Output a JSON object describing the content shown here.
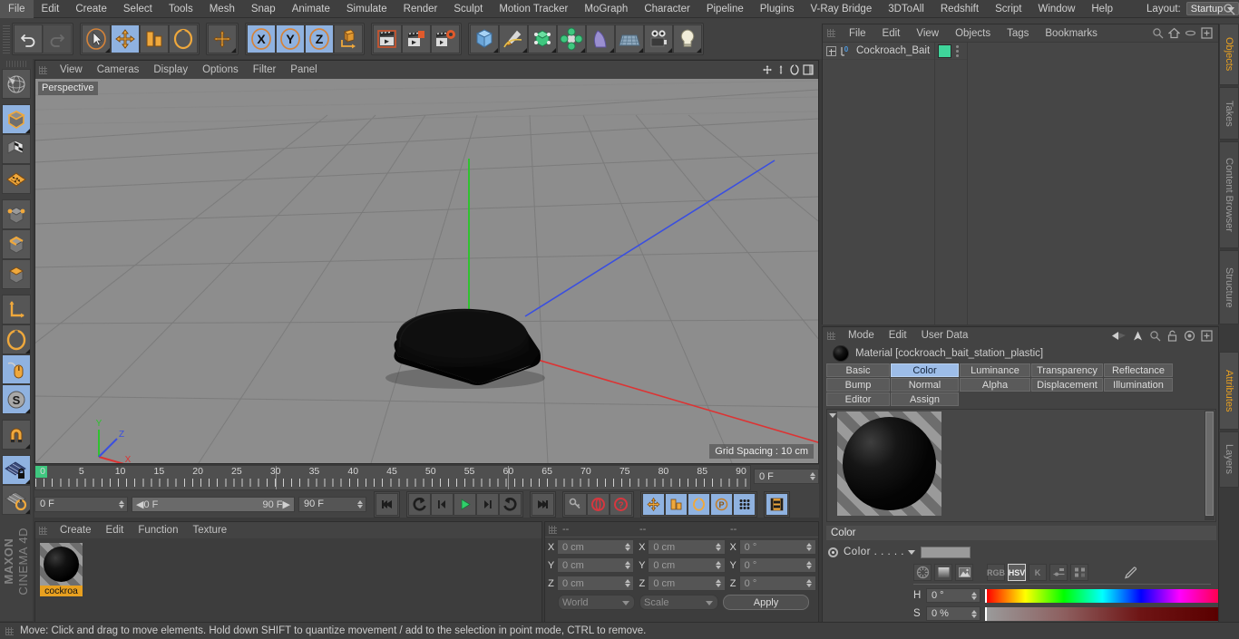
{
  "menubar": {
    "items": [
      "File",
      "Edit",
      "Create",
      "Select",
      "Tools",
      "Mesh",
      "Snap",
      "Animate",
      "Simulate",
      "Render",
      "Sculpt",
      "Motion Tracker",
      "MoGraph",
      "Character",
      "Pipeline",
      "Plugins",
      "V-Ray Bridge",
      "3DToAll",
      "Redshift",
      "Script",
      "Window",
      "Help"
    ],
    "layout_label": "Layout:",
    "layout_value": "Startup",
    "search_icon": "search-icon"
  },
  "toolbar": {
    "groups": [
      {
        "name": "undo-group",
        "buttons": [
          {
            "name": "undo",
            "icon": "undo-arrow-icon",
            "active": false,
            "disabled": false
          },
          {
            "name": "redo",
            "icon": "redo-arrow-icon",
            "active": false,
            "disabled": true
          }
        ]
      },
      {
        "name": "transform-group",
        "buttons": [
          {
            "name": "select",
            "icon": "cursor-arrow-icon",
            "active": false
          },
          {
            "name": "move",
            "icon": "move-axis-icon",
            "active": true
          },
          {
            "name": "scale",
            "icon": "scale-box-icon",
            "active": false
          },
          {
            "name": "rotate",
            "icon": "rotate-ring-icon",
            "active": false
          }
        ]
      },
      {
        "name": "world-group",
        "buttons": [
          {
            "name": "world-coordinate",
            "icon": "plus-axis-icon",
            "active": false
          }
        ]
      },
      {
        "name": "axis-lock-group",
        "buttons": [
          {
            "name": "lock-x",
            "icon": "x-axis-icon",
            "active": true
          },
          {
            "name": "lock-y",
            "icon": "y-axis-icon",
            "active": true
          },
          {
            "name": "lock-z",
            "icon": "z-axis-icon",
            "active": true
          },
          {
            "name": "object-world-toggle",
            "icon": "cube-axis-icon",
            "active": false
          }
        ]
      },
      {
        "name": "render-group",
        "buttons": [
          {
            "name": "render-view",
            "icon": "clapperboard-icon",
            "active": false
          },
          {
            "name": "render-region",
            "icon": "clapper-picture-icon",
            "active": false
          },
          {
            "name": "render-settings",
            "icon": "clapper-gear-icon",
            "active": false
          }
        ]
      },
      {
        "name": "create-group",
        "buttons": [
          {
            "name": "add-cube",
            "icon": "blue-cube-icon",
            "active": false
          },
          {
            "name": "add-spline",
            "icon": "pen-spline-icon",
            "active": false
          },
          {
            "name": "add-generator",
            "icon": "green-cube-icon",
            "active": false
          },
          {
            "name": "add-array",
            "icon": "green-cluster-icon",
            "active": false
          },
          {
            "name": "add-deformer",
            "icon": "bend-deformer-icon",
            "active": false
          },
          {
            "name": "add-environment",
            "icon": "floor-grid-icon",
            "active": false
          },
          {
            "name": "add-camera",
            "icon": "camera-icon",
            "active": false
          },
          {
            "name": "add-light",
            "icon": "light-bulb-icon",
            "active": false
          }
        ]
      }
    ]
  },
  "lefttoolbar": {
    "buttons": [
      {
        "name": "make-editable",
        "icon": "globe-sphere-icon",
        "active": false
      },
      {
        "name": "model-mode",
        "icon": "orange-cube-icon",
        "active": true
      },
      {
        "name": "texture-mode",
        "icon": "checker-cube-icon",
        "active": false
      },
      {
        "name": "uv-mesh-mode",
        "icon": "orange-grid-icon",
        "active": false
      },
      {
        "name": "point-mode",
        "icon": "point-cube-icon",
        "active": false
      },
      {
        "name": "edge-mode",
        "icon": "edge-cube-icon",
        "active": false
      },
      {
        "name": "polygon-mode",
        "icon": "polygon-cube-icon",
        "active": false
      },
      {
        "name": "axis-mode",
        "icon": "axis-corner-icon",
        "active": false
      },
      {
        "name": "enable-snap",
        "icon": "magnet-ring-icon",
        "active": false
      },
      {
        "name": "viewport-solo",
        "icon": "mouse-cursor-icon",
        "active": true
      },
      {
        "name": "soft-selection",
        "icon": "s-compass-icon",
        "active": true
      },
      {
        "name": "snap-settings",
        "icon": "magnet-icon",
        "active": false
      },
      {
        "name": "workplane-lock",
        "icon": "grid-lock-icon",
        "active": true
      },
      {
        "name": "workplane-rotate",
        "icon": "grid-rotate-icon",
        "active": false
      }
    ],
    "brand_line1": "MAXON",
    "brand_line2": "CINEMA 4D"
  },
  "viewport": {
    "menu": [
      "View",
      "Cameras",
      "Display",
      "Options",
      "Filter",
      "Panel"
    ],
    "label": "Perspective",
    "grid_spacing": "Grid Spacing : 10 cm",
    "axis_labels": {
      "x": "X",
      "y": "Y",
      "z": "Z"
    },
    "axis_colors": {
      "x": "#dd3333",
      "y": "#2fc22f",
      "z": "#3a4fe0"
    },
    "background": "#8d8d8d",
    "object_color": "#050505",
    "corner_icons": [
      "move-viewport-icon",
      "pan-viewport-icon",
      "rotate-viewport-icon",
      "maximize-viewport-icon"
    ]
  },
  "timeline": {
    "ticks": [
      "0",
      "5",
      "10",
      "15",
      "20",
      "25",
      "30",
      "35",
      "40",
      "45",
      "50",
      "55",
      "60",
      "65",
      "70",
      "75",
      "80",
      "85",
      "90"
    ],
    "current_frame_field": "0 F",
    "start_field": "0 F",
    "scrub_start": "0 F",
    "scrub_end": "90 F",
    "end_field": "90 F",
    "playhead_frames": [
      30,
      60
    ],
    "transport": [
      {
        "name": "go-to-start",
        "icon": "skip-start-icon"
      },
      {
        "name": "previous-keyframe",
        "icon": "prev-key-icon"
      },
      {
        "name": "step-back",
        "icon": "step-back-icon"
      },
      {
        "name": "play",
        "icon": "play-icon",
        "accent": "#2fd06a"
      },
      {
        "name": "step-forward",
        "icon": "step-forward-icon"
      },
      {
        "name": "next-keyframe",
        "icon": "next-key-icon"
      },
      {
        "name": "go-to-end",
        "icon": "skip-end-icon"
      }
    ],
    "record_group": [
      {
        "name": "autokey",
        "icon": "key-icon",
        "active": false
      },
      {
        "name": "record-active-objects",
        "icon": "record-circle-icon",
        "accent": "#d6373f"
      },
      {
        "name": "keyframe-help",
        "icon": "question-circle-icon",
        "accent": "#d6373f"
      }
    ],
    "key_toggles": [
      {
        "name": "key-position",
        "icon": "move-key-icon",
        "active": true
      },
      {
        "name": "key-scale",
        "icon": "scale-key-icon",
        "active": true
      },
      {
        "name": "key-rotation",
        "icon": "rotate-key-icon",
        "active": true
      },
      {
        "name": "key-param",
        "icon": "p-circle-icon",
        "active": true
      },
      {
        "name": "key-pla",
        "icon": "dots-key-icon",
        "active": true
      }
    ],
    "timeline_toggle": {
      "name": "show-timeline",
      "icon": "filmstrip-icon",
      "active": true
    }
  },
  "material_manager": {
    "menu": [
      "Create",
      "Edit",
      "Function",
      "Texture"
    ],
    "materials": [
      {
        "name": "cockroa",
        "selected": true
      }
    ]
  },
  "coordinates": {
    "headers": [
      "--",
      "--",
      "--"
    ],
    "rows": [
      {
        "axis": "X",
        "position": "0 cm",
        "size": "0 cm",
        "rotation": "0 °"
      },
      {
        "axis": "Y",
        "position": "0 cm",
        "size": "0 cm",
        "rotation": "0 °"
      },
      {
        "axis": "Z",
        "position": "0 cm",
        "size": "0 cm",
        "rotation": "0 °"
      }
    ],
    "coord_system": "World",
    "size_mode": "Scale",
    "apply_label": "Apply"
  },
  "object_manager": {
    "menu": [
      "File",
      "Edit",
      "View",
      "Objects",
      "Tags",
      "Bookmarks"
    ],
    "header_icons": [
      "search-icon",
      "home-icon",
      "ellipse-icon",
      "add-layer-icon"
    ],
    "objects": [
      {
        "name": "Cockroach_Bait",
        "layer_number": "0",
        "tag_color": "#3fd49a"
      }
    ]
  },
  "attribute_manager": {
    "menu": [
      "Mode",
      "Edit",
      "User Data"
    ],
    "header_icons": [
      "back-arrow-icon",
      "up-arrow-icon",
      "search-icon",
      "unlock-icon",
      "target-icon",
      "add-icon"
    ],
    "title": "Material [cockroach_bait_station_plastic]",
    "tabs_row1": [
      "Basic",
      "Color",
      "Luminance",
      "Transparency",
      "Reflectance"
    ],
    "tabs_row2": [
      "Bump",
      "Normal",
      "Alpha",
      "Displacement",
      "Illumination"
    ],
    "tabs_row3": [
      "Editor",
      "Assign"
    ],
    "selected_tab": "Color",
    "section_title": "Color",
    "color_label": "Color . . . . .",
    "color_swatch": "#9a9a9a",
    "color_mode_buttons": [
      "color-wheel-icon",
      "gradient-icon",
      "picture-icon"
    ],
    "color_space_buttons": [
      "RGB",
      "HSV",
      "K"
    ],
    "extra_buttons": [
      "sliders-icon",
      "swatches-icon",
      "eyedropper-icon"
    ],
    "selected_color_space": "HSV",
    "hsv": [
      {
        "label": "H",
        "value": "0 °"
      },
      {
        "label": "S",
        "value": "0 %"
      }
    ]
  },
  "edge_tabs": {
    "top": [
      {
        "label": "Objects",
        "active": true
      },
      {
        "label": "Takes",
        "active": false
      },
      {
        "label": "Content Browser",
        "active": false
      },
      {
        "label": "Structure",
        "active": false
      }
    ],
    "bottom": [
      {
        "label": "Attributes",
        "active": true
      },
      {
        "label": "Layers",
        "active": false
      }
    ]
  },
  "status_bar": {
    "message": "Move: Click and drag to move elements. Hold down SHIFT to quantize movement / add to the selection in point mode, CTRL to remove."
  }
}
